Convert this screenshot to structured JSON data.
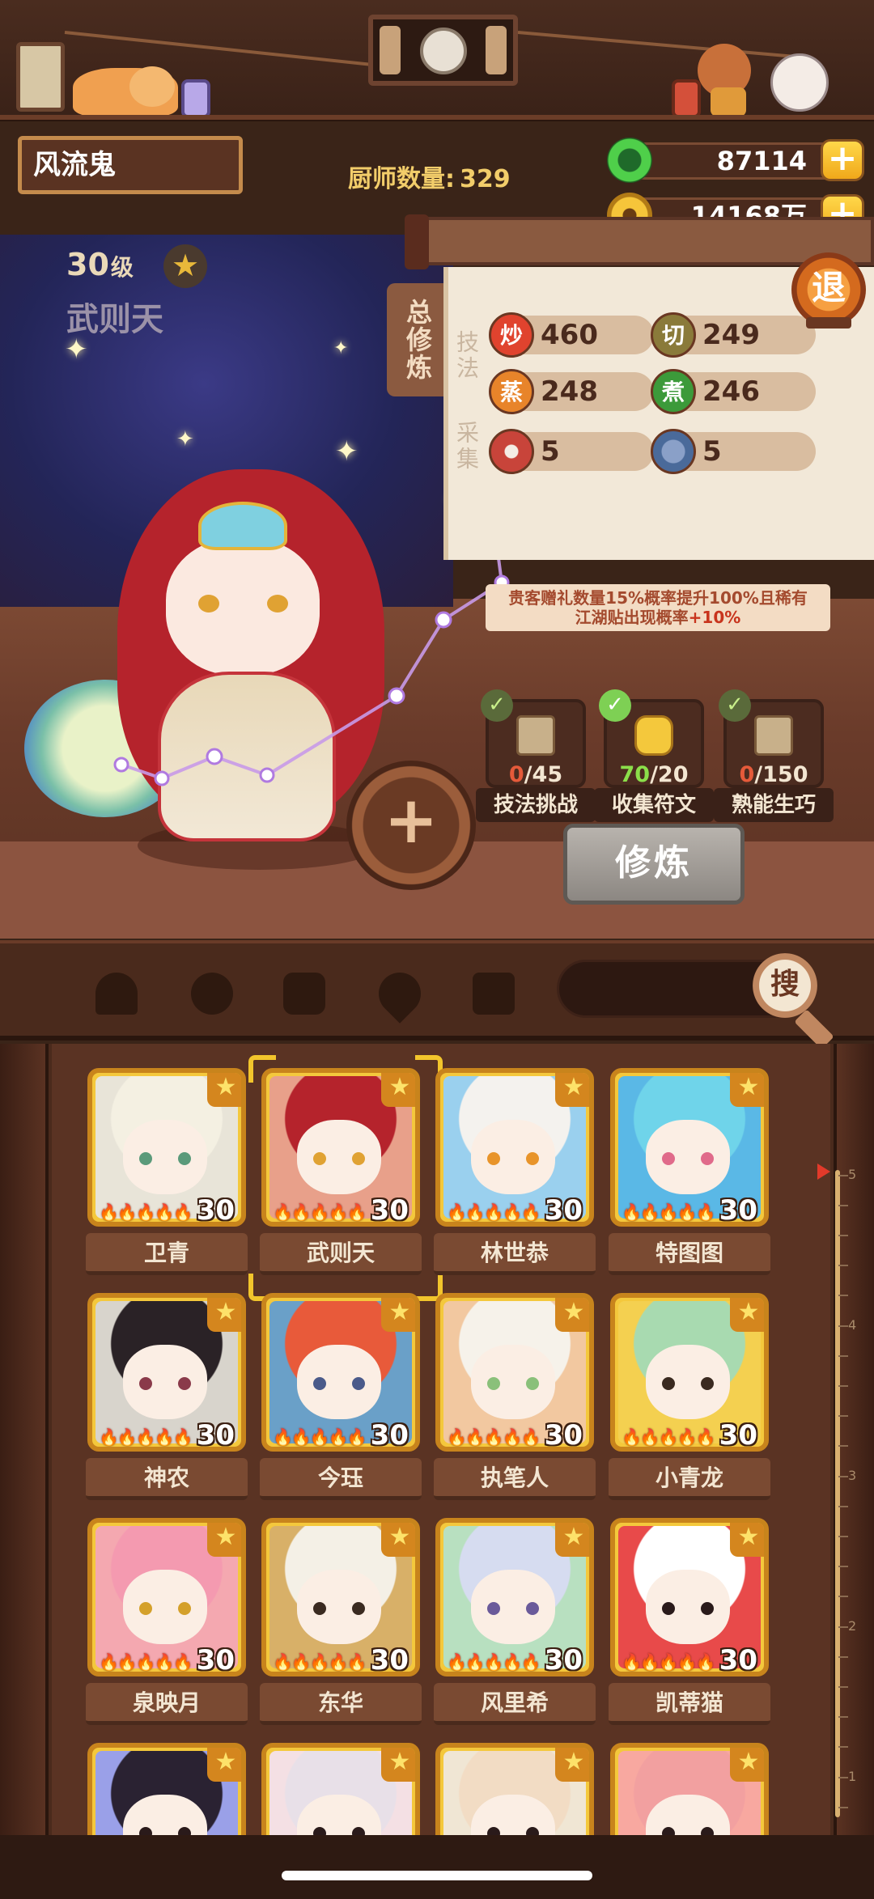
{
  "player": {
    "name": "风流鬼"
  },
  "chef_count": {
    "label": "厨师数量:",
    "value": "329"
  },
  "currency": {
    "jade": {
      "icon": "jade-icon",
      "value": "87114"
    },
    "gold": {
      "icon": "gold-coin-icon",
      "value": "14168万"
    }
  },
  "character": {
    "level": "30",
    "level_unit": "级",
    "name": "武则天"
  },
  "panel": {
    "tab": "总修炼",
    "skill_label": "技法",
    "gather_label": "采集",
    "exit_label": "退",
    "skills": [
      {
        "badge": "炒",
        "value": "460",
        "color": "#e0432e"
      },
      {
        "badge": "切",
        "value": "249",
        "color": "#8a7a3a"
      },
      {
        "badge": "蒸",
        "value": "248",
        "color": "#e8842a"
      },
      {
        "badge": "煮",
        "value": "246",
        "color": "#3c9a3a"
      }
    ],
    "gather": [
      {
        "icon": "meat-icon",
        "value": "5"
      },
      {
        "icon": "fish-icon",
        "value": "5"
      }
    ],
    "bonus_line1": "贵客赠礼数量15%概率提升100%且稀有",
    "bonus_line2_prefix": "江湖贴出现概率",
    "bonus_line2_value": "+10%"
  },
  "tasks": [
    {
      "label": "技法挑战",
      "current": "0",
      "total": "/45",
      "done": false,
      "icon": "scroll-icon"
    },
    {
      "label": "收集符文",
      "current": "70",
      "total": "/20",
      "done": true,
      "icon": "rune-icon"
    },
    {
      "label": "熟能生巧",
      "current": "0",
      "total": "/150",
      "done": false,
      "icon": "scroll-icon"
    }
  ],
  "refine_button": "修炼",
  "search": {
    "button": "搜"
  },
  "filter_icons": [
    "chef-hat-filter-icon",
    "ladle-filter-icon",
    "jar-filter-icon",
    "location-filter-icon",
    "map-filter-icon"
  ],
  "chefs": [
    {
      "name": "卫青",
      "level": "30",
      "bg": "#e8e4d8",
      "hair": "#f4f0e2",
      "eye": "#5a9a7a"
    },
    {
      "name": "武则天",
      "level": "30",
      "bg": "#e8a08a",
      "hair": "#b5232c",
      "eye": "#e0a233",
      "selected": true
    },
    {
      "name": "林世恭",
      "level": "30",
      "bg": "#9ad0ee",
      "hair": "#f4f2ee",
      "eye": "#e8942a"
    },
    {
      "name": "特图图",
      "level": "30",
      "bg": "#5ab8e6",
      "hair": "#6fd4ea",
      "eye": "#e06a8a"
    },
    {
      "name": "神农",
      "level": "30",
      "bg": "#d8d4cc",
      "hair": "#2a2226",
      "eye": "#8a3a4a"
    },
    {
      "name": "今珏",
      "level": "30",
      "bg": "#6aa0c8",
      "hair": "#e85a3a",
      "eye": "#4a5a8a"
    },
    {
      "name": "执笔人",
      "level": "30",
      "bg": "#f2c8a0",
      "hair": "#f6f2ea",
      "eye": "#8ac07a"
    },
    {
      "name": "小青龙",
      "level": "30",
      "bg": "#f4d050",
      "hair": "#a8dab0",
      "eye": "#3a2a20"
    },
    {
      "name": "泉映月",
      "level": "30",
      "bg": "#f4a8b0",
      "hair": "#f49ab0",
      "eye": "#d4a02a"
    },
    {
      "name": "东华",
      "level": "30",
      "bg": "#d8b068",
      "hair": "#f4f0e6",
      "eye": "#3a2a20"
    },
    {
      "name": "风里希",
      "level": "30",
      "bg": "#b8e0c0",
      "hair": "#d6dcf0",
      "eye": "#6a5a9a"
    },
    {
      "name": "凯蒂猫",
      "level": "30",
      "bg": "#e84a4a",
      "hair": "#ffffff",
      "eye": "#2a1a1a"
    },
    {
      "name": "",
      "level": "",
      "bg": "#9aa0e8",
      "hair": "#2a2232",
      "eye": "#2a1a1a"
    },
    {
      "name": "",
      "level": "",
      "bg": "#f4e0e4",
      "hair": "#e8e0e8",
      "eye": "#2a1a1a"
    },
    {
      "name": "",
      "level": "",
      "bg": "#f0e6d4",
      "hair": "#f2dcc4",
      "eye": "#2a1a1a"
    },
    {
      "name": "",
      "level": "",
      "bg": "#f8a8a0",
      "hair": "#f2a0a0",
      "eye": "#2a1a1a"
    }
  ],
  "ruler_ticks": [
    "5",
    "4",
    "3",
    "2",
    "1"
  ],
  "colors": {
    "gold": "#f4c83c",
    "wood_dark": "#4a2a1c",
    "panel_bg": "#f2e8d8",
    "accent_red": "#e0432e"
  }
}
